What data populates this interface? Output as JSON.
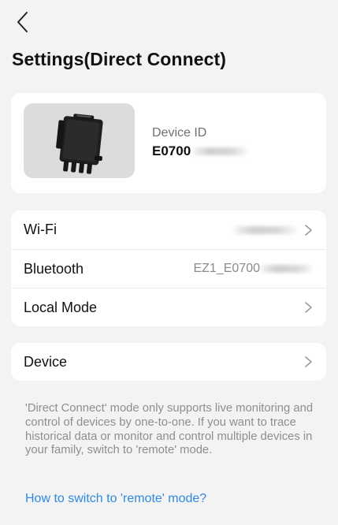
{
  "header": {
    "title": "Settings(Direct Connect)"
  },
  "device": {
    "id_label": "Device ID",
    "id_value": "E0700"
  },
  "settings_list": [
    {
      "label": "Wi-Fi",
      "value": ""
    },
    {
      "label": "Bluetooth",
      "value": "EZ1_E0700"
    },
    {
      "label": "Local Mode",
      "value": ""
    }
  ],
  "device_row": {
    "label": "Device"
  },
  "info": {
    "text": "'Direct Connect' mode only supports live monitoring and control of devices by one-to-one. If you want to trace historical data or monitor and control multiple devices in your family, switch to 'remote' mode.",
    "link": "How to switch to 'remote' mode?"
  },
  "colors": {
    "background": "#f3f3f3",
    "card": "#ffffff",
    "link": "#2f8ae0",
    "secondary_text": "#8e8e8e"
  }
}
